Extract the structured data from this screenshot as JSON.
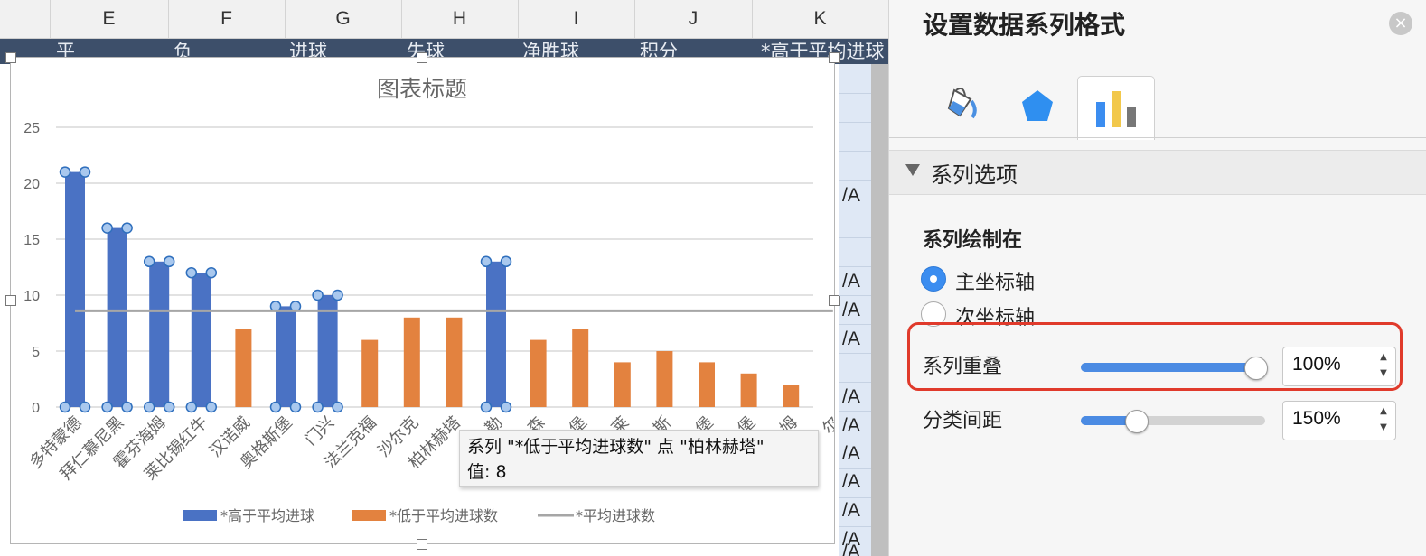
{
  "sheet": {
    "columns": [
      "E",
      "F",
      "G",
      "H",
      "I",
      "J",
      "K"
    ],
    "dark_row_texts": [
      "平",
      "负",
      "进球",
      "失球",
      "净胜球",
      "积分",
      "*高于平均进球"
    ],
    "right_col_values": [
      "/A",
      "/A",
      "/A",
      "/A",
      "/A",
      "/A",
      "/A",
      "/A",
      "/A",
      "/A",
      "/A"
    ]
  },
  "chart_data": {
    "type": "bar",
    "title": "图表标题",
    "categories": [
      "多特蒙德",
      "拜仁慕尼黑",
      "霍芬海姆",
      "莱比锡红牛",
      "汉诺威",
      "奥格斯堡",
      "门兴",
      "法兰克福",
      "沙尔克",
      "柏林赫塔",
      "勒",
      "森",
      "堡",
      "莱",
      "斯",
      "堡",
      "堡",
      "姆",
      "尔"
    ],
    "category_labels_visible": [
      "多特蒙德",
      "拜仁慕尼黑",
      "霍芬海姆",
      "莱比锡红牛",
      "汉诺威",
      "奥格斯堡",
      "门兴",
      "法兰克福",
      "沙尔克",
      "柏林赫塔",
      "勒",
      "森",
      "堡",
      "莱",
      "斯",
      "堡",
      "堡",
      "姆",
      "尔"
    ],
    "series": [
      {
        "name": "*高于平均进球",
        "color": "#4a72c4",
        "values": [
          21,
          16,
          13,
          12,
          null,
          9,
          10,
          null,
          null,
          null,
          13,
          null,
          null,
          null,
          null,
          null,
          null,
          null,
          null
        ]
      },
      {
        "name": "*低于平均进球数",
        "color": "#e3823f",
        "values": [
          null,
          null,
          null,
          null,
          7,
          null,
          null,
          6,
          8,
          8,
          null,
          6,
          7,
          4,
          5,
          4,
          3,
          2,
          null
        ]
      },
      {
        "name": "*平均进球数",
        "color": "#a6a6a6",
        "type": "line",
        "value": 8.6
      }
    ],
    "y_ticks": [
      "0",
      "5",
      "10",
      "15",
      "20",
      "25"
    ],
    "ylim": [
      0,
      25
    ],
    "grid": true,
    "legend": "bottom"
  },
  "tooltip": {
    "line1": "系列 \"*低于平均进球数\" 点 \"柏林赫塔\"",
    "line2": "值: 8"
  },
  "panel": {
    "title": "设置数据系列格式",
    "close_label": "×",
    "section_label": "系列选项",
    "plot_on_label": "系列绘制在",
    "primary_axis_label": "主坐标轴",
    "secondary_axis_label": "次坐标轴",
    "overlap_label": "系列重叠",
    "overlap_value": "100%",
    "overlap_fraction": 1.0,
    "gap_label": "分类间距",
    "gap_value": "150%",
    "gap_fraction": 0.3,
    "accent_color": "#e03a2b"
  }
}
